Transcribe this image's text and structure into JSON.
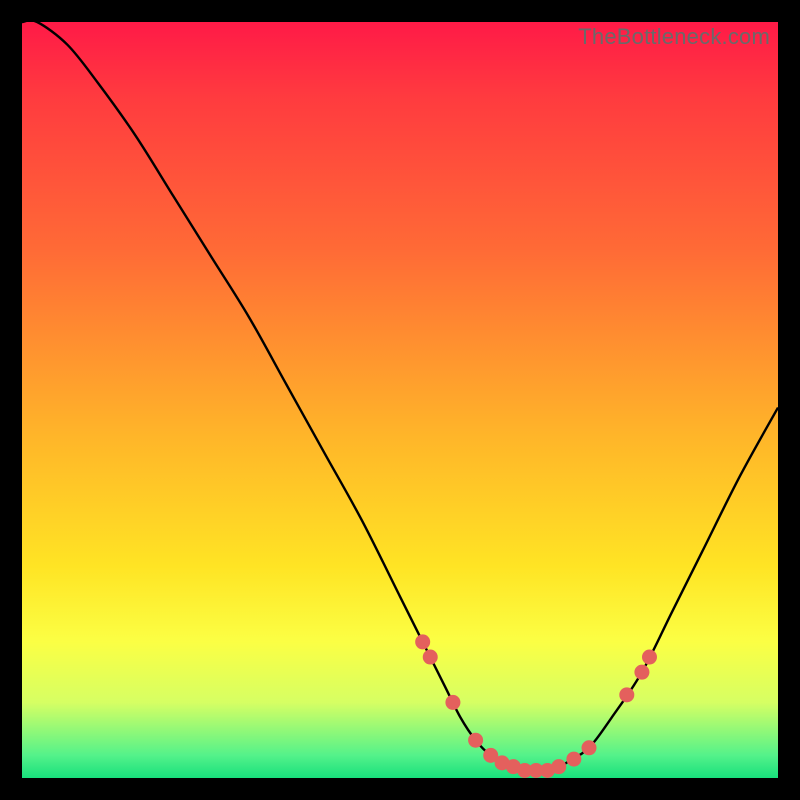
{
  "attribution": "TheBottleneck.com",
  "colors": {
    "frame_bg": "#000000",
    "curve_stroke": "#000000",
    "dot_fill": "#e4605d",
    "gradient_stops": [
      "#ff1a47",
      "#ff3b3f",
      "#ff6a36",
      "#ffb629",
      "#ffe424",
      "#fbff44",
      "#d6ff63",
      "#54f28a",
      "#18e07c"
    ]
  },
  "chart_data": {
    "type": "line",
    "title": "",
    "xlabel": "",
    "ylabel": "",
    "xlim": [
      0,
      100
    ],
    "ylim": [
      0,
      100
    ],
    "x": [
      0,
      2,
      6,
      10,
      15,
      20,
      25,
      30,
      35,
      40,
      45,
      50,
      53,
      56,
      58,
      60,
      62,
      64,
      66,
      68,
      70,
      72,
      75,
      78,
      82,
      86,
      90,
      95,
      100
    ],
    "y": [
      100,
      100,
      97,
      92,
      85,
      77,
      69,
      61,
      52,
      43,
      34,
      24,
      18,
      12,
      8,
      5,
      3,
      2,
      1,
      1,
      1,
      2,
      4,
      8,
      14,
      22,
      30,
      40,
      49
    ],
    "dots": [
      {
        "x": 53,
        "y": 18
      },
      {
        "x": 54,
        "y": 16
      },
      {
        "x": 57,
        "y": 10
      },
      {
        "x": 60,
        "y": 5
      },
      {
        "x": 62,
        "y": 3
      },
      {
        "x": 63.5,
        "y": 2
      },
      {
        "x": 65,
        "y": 1.5
      },
      {
        "x": 66.5,
        "y": 1
      },
      {
        "x": 68,
        "y": 1
      },
      {
        "x": 69.5,
        "y": 1
      },
      {
        "x": 71,
        "y": 1.5
      },
      {
        "x": 73,
        "y": 2.5
      },
      {
        "x": 75,
        "y": 4
      },
      {
        "x": 80,
        "y": 11
      },
      {
        "x": 82,
        "y": 14
      },
      {
        "x": 83,
        "y": 16
      }
    ]
  }
}
